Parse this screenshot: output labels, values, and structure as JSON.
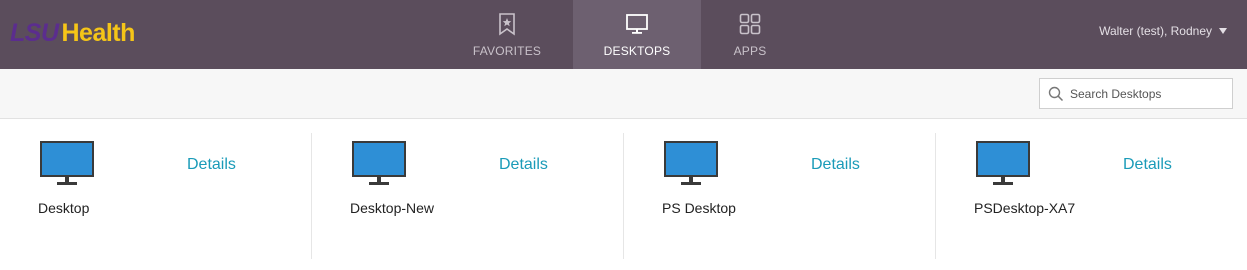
{
  "brand": {
    "lsu": "LSU",
    "health": "Health"
  },
  "nav": {
    "tabs": [
      {
        "label": "FAVORITES",
        "icon": "bookmark-icon",
        "active": false
      },
      {
        "label": "DESKTOPS",
        "icon": "monitor-icon",
        "active": true
      },
      {
        "label": "APPS",
        "icon": "apps-grid-icon",
        "active": false
      }
    ]
  },
  "user": {
    "name": "Walter (test), Rodney"
  },
  "search": {
    "placeholder": "Search Desktops",
    "value": ""
  },
  "desktops": [
    {
      "name": "Desktop",
      "details_label": "Details"
    },
    {
      "name": "Desktop-New",
      "details_label": "Details"
    },
    {
      "name": "PS Desktop",
      "details_label": "Details"
    },
    {
      "name": "PSDesktop-XA7",
      "details_label": "Details"
    }
  ],
  "colors": {
    "topbar": "#5b4d5c",
    "active_tab": "#6d6070",
    "link": "#1a9bb8",
    "brand_purple": "#5b2d8e",
    "brand_gold": "#f5c518"
  }
}
